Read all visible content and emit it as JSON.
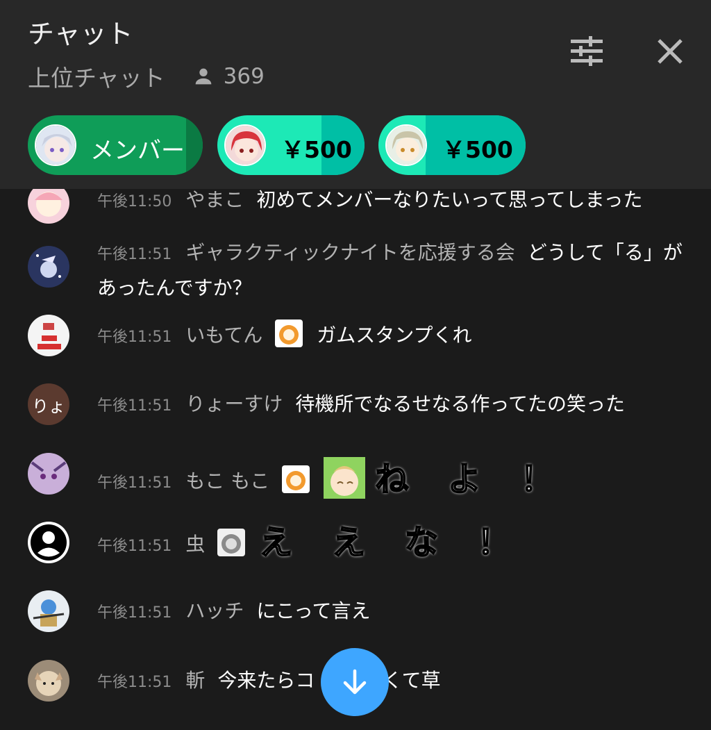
{
  "header": {
    "title": "チャット",
    "subtitle": "上位チャット",
    "viewer_count": "369"
  },
  "tickers": [
    {
      "label": "メンバー",
      "color": "#0f9d58"
    },
    {
      "label": "￥500",
      "color": "#1de9b6"
    },
    {
      "label": "￥500",
      "color": "#1de9b6"
    }
  ],
  "messages": [
    {
      "time": "午後11:50",
      "author": "やまこ",
      "text": "初めてメンバーなりたいって思ってしまった"
    },
    {
      "time": "午後11:51",
      "author": "ギャラクティックナイトを応援する会",
      "text": "どうして「る」があったんですか？"
    },
    {
      "time": "午後11:51",
      "author": "いもてん",
      "text": "ガムスタンプくれ"
    },
    {
      "time": "午後11:51",
      "author": "りょーすけ",
      "avatar_text": "りょ",
      "text": "待機所でなるせなる作ってたの笑った"
    },
    {
      "time": "午後11:51",
      "author": "もこ もこ",
      "text": "ね よ ！"
    },
    {
      "time": "午後11:51",
      "author": "虫",
      "text": "え え な ！"
    },
    {
      "time": "午後11:51",
      "author": "ハッチ",
      "text": "にこって言え"
    },
    {
      "time": "午後11:51",
      "author": "斬",
      "text": "今来たらコ",
      "text_tail": "ごくて草"
    }
  ]
}
